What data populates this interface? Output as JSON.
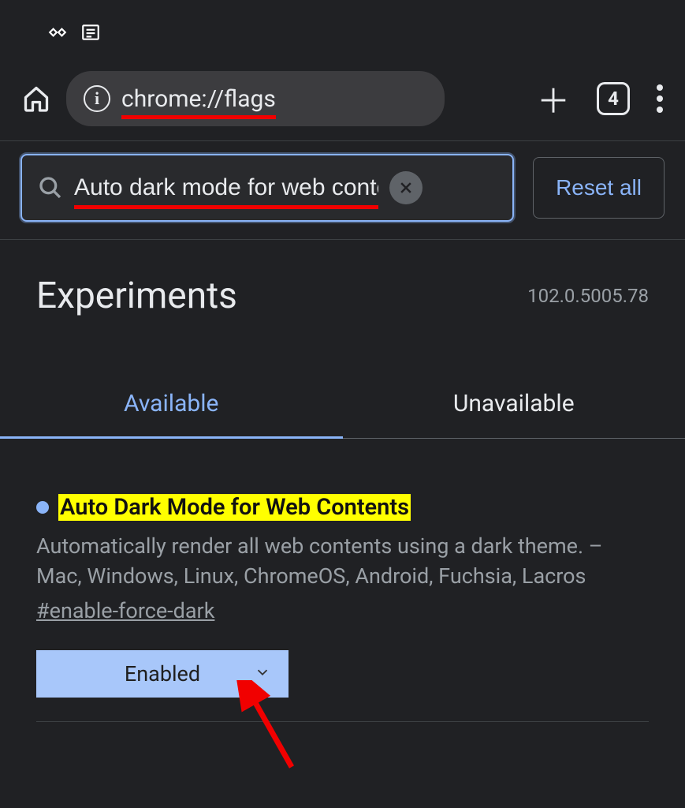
{
  "toolbar": {
    "url": "chrome://flags",
    "tab_count": "4"
  },
  "search": {
    "value": "Auto dark mode for web contents",
    "reset_label": "Reset all"
  },
  "header": {
    "title": "Experiments",
    "version": "102.0.5005.78"
  },
  "tabs": {
    "available": "Available",
    "unavailable": "Unavailable"
  },
  "flag": {
    "title": "Auto Dark Mode for Web Contents",
    "description": "Automatically render all web contents using a dark theme. – Mac, Windows, Linux, ChromeOS, Android, Fuchsia, Lacros",
    "name": "#enable-force-dark",
    "selected": "Enabled"
  }
}
